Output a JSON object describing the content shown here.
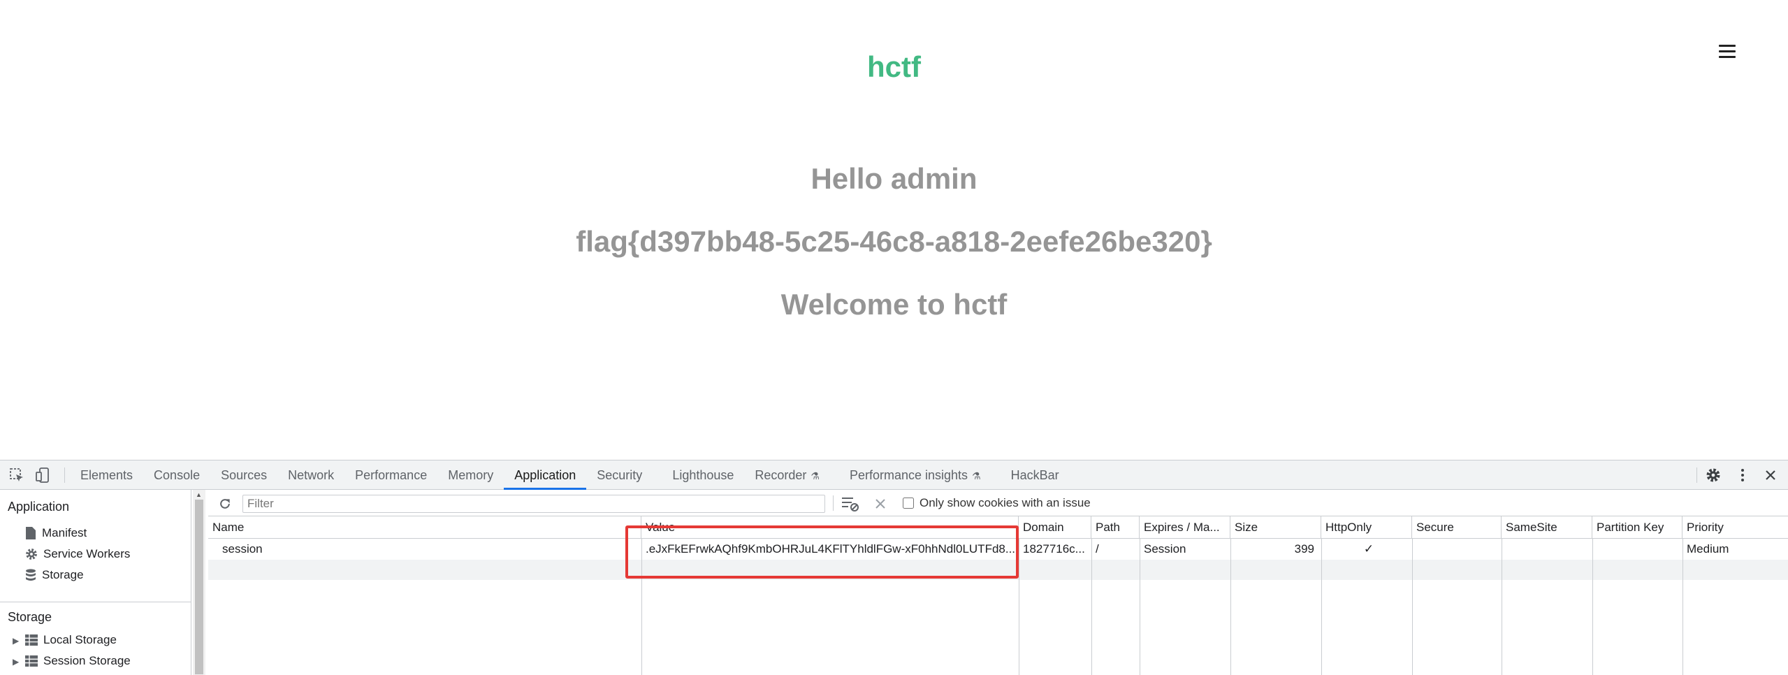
{
  "page": {
    "brand": "hctf",
    "hello": "Hello admin",
    "flag": "flag{d397bb48-5c25-46c8-a818-2eefe26be320}",
    "welcome": "Welcome to hctf"
  },
  "devtools": {
    "tabs": [
      {
        "label": "Elements"
      },
      {
        "label": "Console"
      },
      {
        "label": "Sources"
      },
      {
        "label": "Network"
      },
      {
        "label": "Performance"
      },
      {
        "label": "Memory"
      },
      {
        "label": "Application"
      },
      {
        "label": "Security"
      },
      {
        "label": "Lighthouse"
      },
      {
        "label": "Recorder"
      },
      {
        "label": "Performance insights"
      },
      {
        "label": "HackBar"
      }
    ],
    "active_tab": "Application",
    "sidebar": {
      "application_heading": "Application",
      "application_items": [
        {
          "label": "Manifest",
          "icon": "file-icon"
        },
        {
          "label": "Service Workers",
          "icon": "gear-icon"
        },
        {
          "label": "Storage",
          "icon": "database-icon"
        }
      ],
      "storage_heading": "Storage",
      "storage_items": [
        {
          "label": "Local Storage",
          "icon": "grid-icon"
        },
        {
          "label": "Session Storage",
          "icon": "grid-icon"
        }
      ]
    },
    "toolbar": {
      "filter_placeholder": "Filter",
      "only_issue_label": "Only show cookies with an issue"
    },
    "table": {
      "headers": [
        "Name",
        "Value",
        "Domain",
        "Path",
        "Expires / Ma...",
        "Size",
        "HttpOnly",
        "Secure",
        "SameSite",
        "Partition Key",
        "Priority"
      ],
      "rows": [
        {
          "name": "session",
          "value": ".eJxFkEFrwkAQhf9KmbOHRJuL4KFlTYhldlFGw-xF0hhNdl0LUTFd8...",
          "domain": "1827716c...",
          "path": "/",
          "expires": "Session",
          "size": "399",
          "httponly": "✓",
          "secure": "",
          "samesite": "",
          "partition_key": "",
          "priority": "Medium"
        }
      ]
    }
  }
}
